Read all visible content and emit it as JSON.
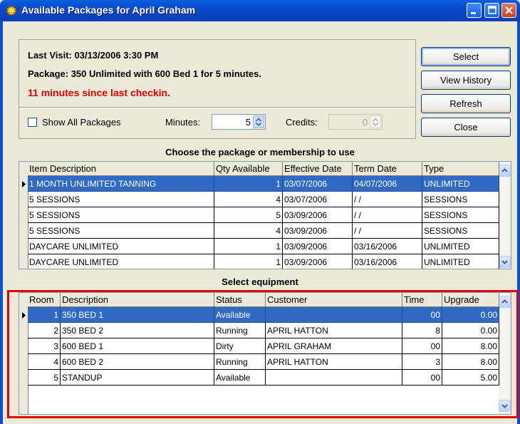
{
  "window": {
    "title": "Available Packages for April Graham"
  },
  "info": {
    "last_visit": "Last Visit: 03/13/2006  3:30 PM",
    "package": "Package:  350 Unlimited with 600 Bed 1 for  5 minutes.",
    "alert": "11 minutes since last checkin.",
    "alert_color": "#e00000",
    "show_all_label": "Show All Packages",
    "show_all_checked": false,
    "minutes_label": "Minutes:",
    "minutes_value": "5",
    "credits_label": "Credits:",
    "credits_value": "0"
  },
  "buttons": {
    "select": "Select",
    "view_history": "View History",
    "refresh": "Refresh",
    "close": "Close"
  },
  "packages": {
    "title": "Choose the package or membership to use",
    "columns": [
      "Item Description",
      "Qty Available",
      "Effective Date",
      "Term Date",
      "Type"
    ],
    "rows": [
      [
        "1 MONTH UNLIMITED TANNING",
        "1",
        "03/07/2006",
        "04/07/2006",
        "UNLIMITED"
      ],
      [
        "5 SESSIONS",
        "4",
        "03/07/2006",
        "/ /",
        "SESSIONS"
      ],
      [
        "5 SESSIONS",
        "5",
        "03/09/2006",
        "/ /",
        "SESSIONS"
      ],
      [
        "5 SESSIONS",
        "4",
        "03/09/2006",
        "/ /",
        "SESSIONS"
      ],
      [
        "DAYCARE UNLIMITED",
        "1",
        "03/09/2006",
        "03/16/2006",
        "UNLIMITED"
      ],
      [
        "DAYCARE UNLIMITED",
        "1",
        "03/09/2006",
        "03/16/2006",
        "UNLIMITED"
      ]
    ]
  },
  "equipment": {
    "title": "Select equipment",
    "columns": [
      "Room",
      "Description",
      "Status",
      "Customer",
      "Time",
      "Upgrade"
    ],
    "rows": [
      [
        "1",
        "350 BED 1",
        "Available",
        "",
        "00",
        "0.00"
      ],
      [
        "2",
        "350 BED 2",
        "Running",
        "APRIL HATTON",
        "8",
        "0.00"
      ],
      [
        "3",
        "600 BED 1",
        "Dirty",
        "APRIL GRAHAM",
        "00",
        "8.00"
      ],
      [
        "4",
        "600 BED 2",
        "Running",
        "APRIL HATTON",
        "3",
        "8.00"
      ],
      [
        "5",
        "STANDUP",
        "Available",
        "",
        "00",
        "5.00"
      ]
    ]
  },
  "colors": {
    "selection": "#316ac5",
    "titlebar": "#0848c8",
    "highlight_box": "#e00000"
  }
}
